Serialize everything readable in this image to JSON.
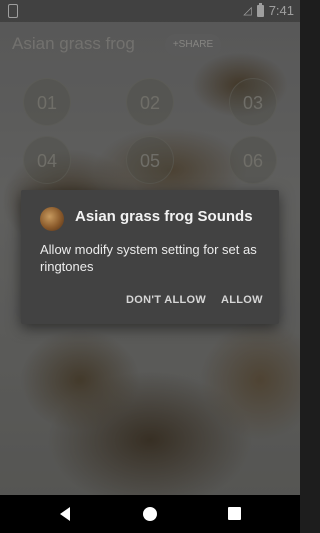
{
  "status_bar": {
    "time": "7:41"
  },
  "app_bar": {
    "title": "Asian grass frog",
    "share_label": "+SHARE"
  },
  "grid": {
    "labels": [
      "01",
      "02",
      "03",
      "04",
      "05",
      "06"
    ]
  },
  "dialog": {
    "title": "Asian grass frog Sounds",
    "message": "Allow modify system setting for set as ringtones",
    "deny_label": "DON'T ALLOW",
    "allow_label": "ALLOW"
  },
  "colors": {
    "dialog_bg": "#424242",
    "nav_bg": "#000000"
  },
  "icons": [
    "sd-card-icon",
    "no-signal-icon",
    "battery-icon",
    "back-icon",
    "home-icon",
    "recents-icon",
    "app-icon"
  ]
}
